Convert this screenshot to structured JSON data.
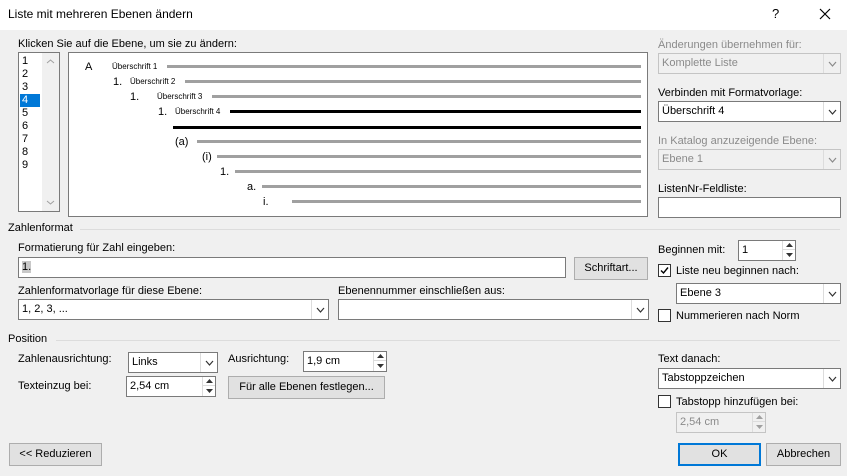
{
  "window": {
    "title": "Liste mit mehreren Ebenen ändern",
    "help_label": "?",
    "close_label": "✕"
  },
  "level_select": {
    "label": "Klicken Sie auf die Ebene, um sie zu ändern:",
    "levels": [
      "1",
      "2",
      "3",
      "4",
      "5",
      "6",
      "7",
      "8",
      "9"
    ],
    "selected": "4"
  },
  "preview": {
    "rows": [
      {
        "num": "A",
        "text": "Überschrift 1"
      },
      {
        "num": "1.",
        "text": "Überschrift 2"
      },
      {
        "num": "1.",
        "text": "Überschrift 3"
      },
      {
        "num": "1.",
        "text": "Überschrift 4"
      },
      {
        "num": "",
        "text": ""
      },
      {
        "num": "(a)",
        "text": ""
      },
      {
        "num": "(i)",
        "text": ""
      },
      {
        "num": "1.",
        "text": ""
      },
      {
        "num": "a.",
        "text": ""
      },
      {
        "num": "i.",
        "text": ""
      }
    ]
  },
  "right_panel": {
    "apply_label": "Änderungen übernehmen für:",
    "apply_value": "Komplette Liste",
    "link_label": "Verbinden mit Formatvorlage:",
    "link_value": "Überschrift 4",
    "gallery_label": "In Katalog anzuzeigende Ebene:",
    "gallery_value": "Ebene 1",
    "listnum_label": "ListenNr-Feldliste:",
    "listnum_value": ""
  },
  "number_format": {
    "section_label": "Zahlenformat",
    "format_label": "Formatierung für Zahl eingeben:",
    "format_value": "1.",
    "font_button": "Schriftart...",
    "style_label": "Zahlenformatvorlage für diese Ebene:",
    "style_value": "1, 2, 3, ...",
    "include_label": "Ebenennummer einschließen aus:",
    "include_value": "",
    "start_label": "Beginnen mit:",
    "start_value": "1",
    "restart_label": "Liste neu beginnen nach:",
    "restart_checked": true,
    "restart_value": "Ebene 3",
    "legal_label": "Nummerieren nach Norm",
    "legal_checked": false
  },
  "position": {
    "section_label": "Position",
    "alignment_label": "Zahlenausrichtung:",
    "alignment_value": "Links",
    "aligned_at_label": "Ausrichtung:",
    "aligned_at_value": "1,9 cm",
    "indent_label": "Texteinzug bei:",
    "indent_value": "2,54 cm",
    "set_all_button": "Für alle Ebenen festlegen...",
    "follow_label": "Text danach:",
    "follow_value": "Tabstoppzeichen",
    "tab_label": "Tabstopp hinzufügen bei:",
    "tab_checked": false,
    "tab_value": "2,54 cm"
  },
  "buttons": {
    "less": "<< Reduzieren",
    "ok": "OK",
    "cancel": "Abbrechen"
  }
}
